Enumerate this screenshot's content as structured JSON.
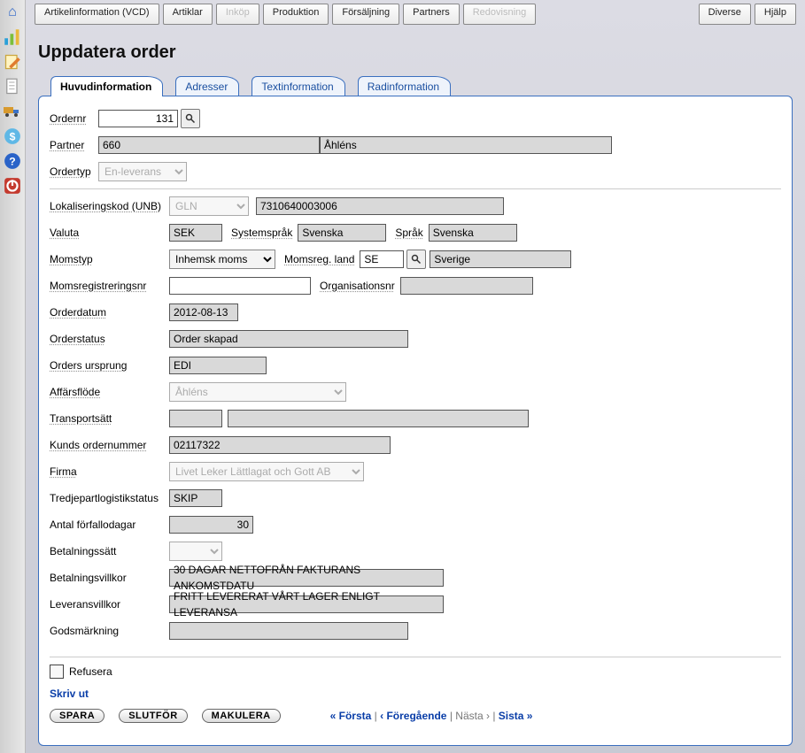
{
  "topnav": {
    "artikelinfo": "Artikelinformation (VCD)",
    "artiklar": "Artiklar",
    "inkop": "Inköp",
    "produktion": "Produktion",
    "forsaljning": "Försäljning",
    "partners": "Partners",
    "redovisning": "Redovisning",
    "diverse": "Diverse",
    "hjalp": "Hjälp"
  },
  "page": {
    "title": "Uppdatera order"
  },
  "tabs": {
    "huvud": "Huvudinformation",
    "adresser": "Adresser",
    "textinfo": "Textinformation",
    "radinfo": "Radinformation"
  },
  "labels": {
    "ordernr": "Ordernr",
    "partner": "Partner",
    "ordertyp": "Ordertyp",
    "lokal": "Lokaliseringskod (UNB)",
    "valuta": "Valuta",
    "systemsprak": "Systemspråk",
    "sprak": "Språk",
    "momstyp": "Momstyp",
    "momsregland": "Momsreg. land",
    "momsregnr": "Momsregistreringsnr",
    "orgnr": "Organisationsnr",
    "orderdatum": "Orderdatum",
    "orderstatus": "Orderstatus",
    "ordersursprung": "Orders ursprung",
    "affarsflode": "Affärsflöde",
    "transportsatt": "Transportsätt",
    "kundsordernr": "Kunds ordernummer",
    "firma": "Firma",
    "tpl": "Tredjepartlogistikstatus",
    "antalforfall": "Antal förfallodagar",
    "betalsatt": "Betalningssätt",
    "betalvillkor": "Betalningsvillkor",
    "levvillkor": "Leveransvillkor",
    "godsmark": "Godsmärkning"
  },
  "values": {
    "ordernr": "131",
    "partner_kod": "660",
    "partner_namn": "Åhléns",
    "ordertyp": "En-leverans",
    "lokal_typ": "GLN",
    "lokal_kod": "7310640003006",
    "valuta": "SEK",
    "systemsprak": "Svenska",
    "sprak": "Svenska",
    "momstyp": "Inhemsk moms",
    "momsregland": "SE",
    "momsregland_namn": "Sverige",
    "momsregnr": "",
    "orgnr": "",
    "orderdatum": "2012-08-13",
    "orderstatus": "Order skapad",
    "ordersursprung": "EDI",
    "affarsflode": "Åhléns",
    "transportsatt_kod": "",
    "transportsatt_namn": "",
    "kundsordernr": "02117322",
    "firma": "Livet Leker Lättlagat och Gott AB",
    "tpl": "SKIP",
    "antalforfall": "30",
    "betalsatt": "",
    "betalvillkor": "30 DAGAR NETTOFRÅN FAKTURANS ANKOMSTDATU",
    "levvillkor": "FRITT LEVERERAT VÅRT LAGER ENLIGT LEVERANSA",
    "godsmark": ""
  },
  "footer": {
    "refusera": "Refusera",
    "skrivut": "Skriv ut",
    "spara": "SPARA",
    "slutfor": "SLUTFÖR",
    "makulera": "MAKULERA",
    "forsta": "« Första",
    "foregaende": "‹ Föregående",
    "nasta": "Nästa ›",
    "sista": "Sista »",
    "sep": "|"
  }
}
